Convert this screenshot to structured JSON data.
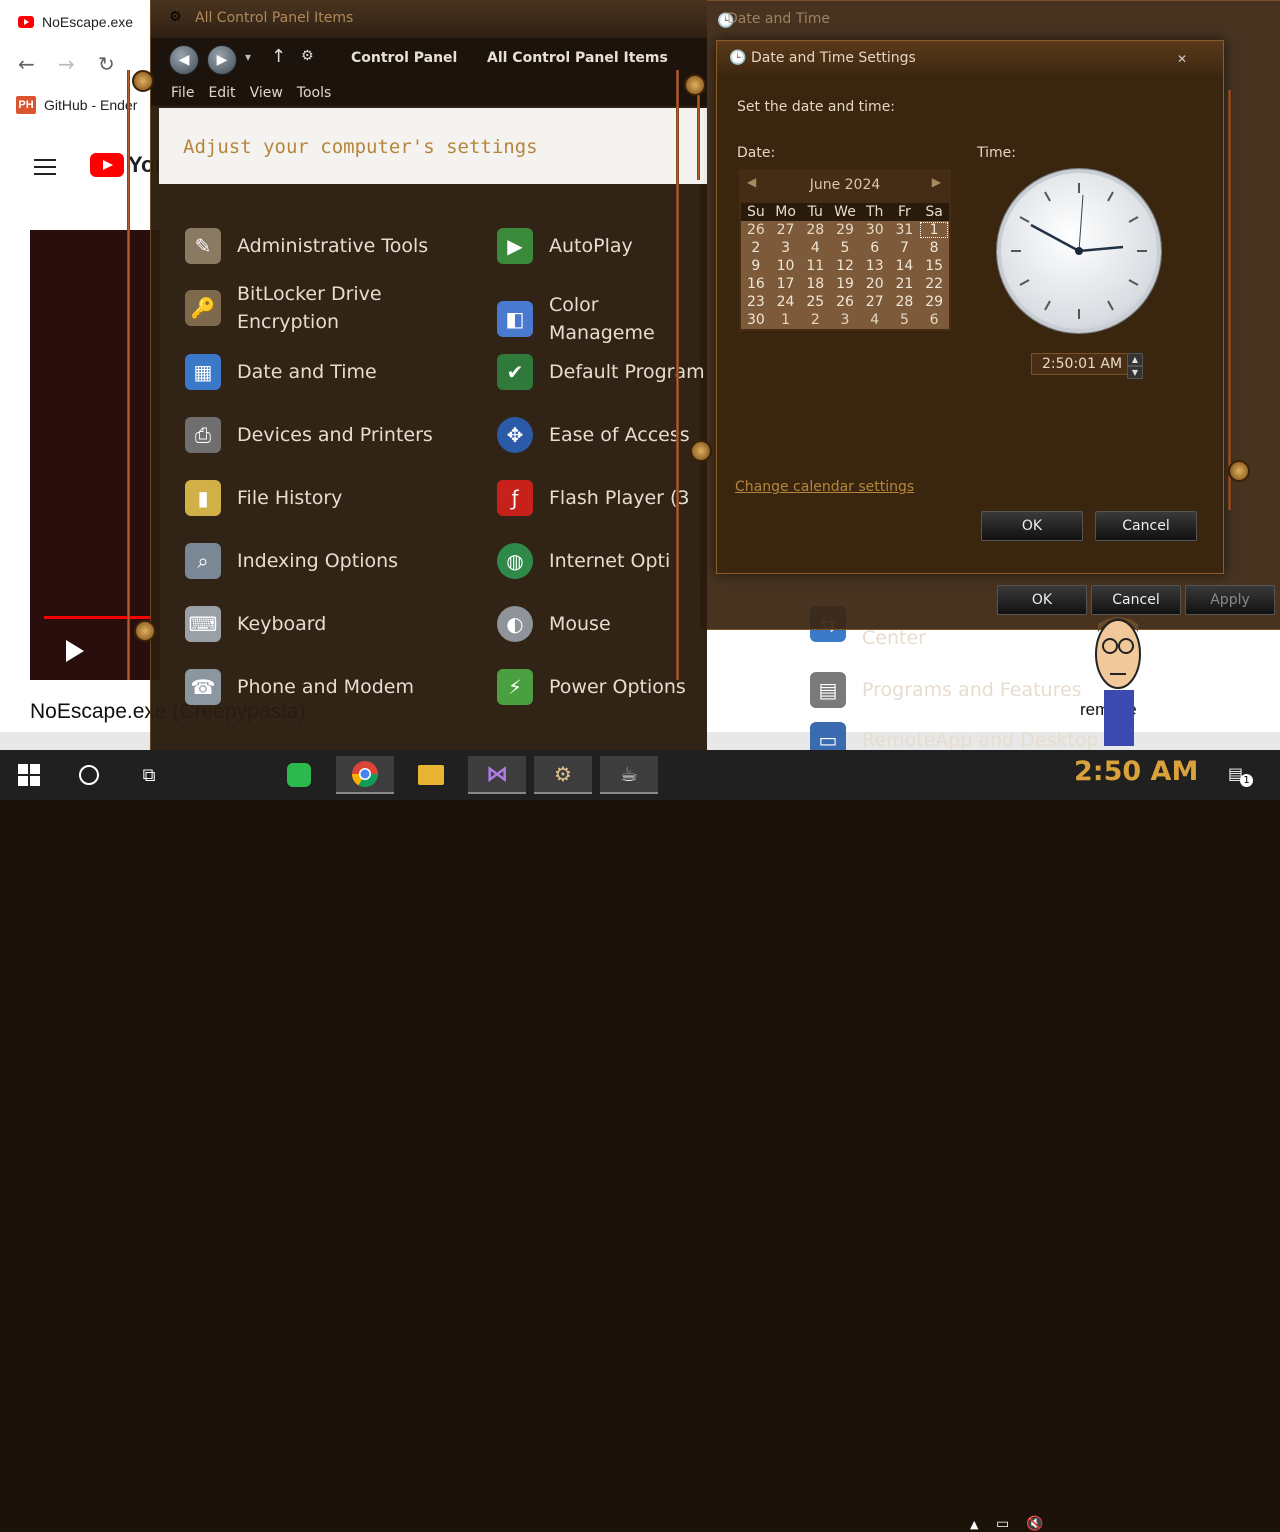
{
  "browser": {
    "tab_title": "NoEscape.exe",
    "bookmark_label": "GitHub - Ender",
    "bookmark_icon_text": "PH",
    "youtube_logo_text": "YouTube",
    "video_title": "NoEscape.exe (Creepypasta)",
    "remove_text": "remove"
  },
  "control_panel": {
    "window_title": "All Control Panel Items",
    "breadcrumb": [
      "Control Panel",
      "All Control Panel Items"
    ],
    "menu": [
      "File",
      "Edit",
      "View",
      "Tools"
    ],
    "heading": "Adjust your computer's settings",
    "items_left": [
      {
        "label": "Administrative Tools",
        "icon": "admin-tools-icon",
        "color": "#8a7a62"
      },
      {
        "label": "BitLocker Drive Encryption",
        "icon": "bitlocker-icon",
        "color": "#7d6a4c"
      },
      {
        "label": "Date and Time",
        "icon": "date-time-icon",
        "color": "#3a78c8"
      },
      {
        "label": "Devices and Printers",
        "icon": "printer-icon",
        "color": "#6f6f6f"
      },
      {
        "label": "File History",
        "icon": "file-history-icon",
        "color": "#d2b048"
      },
      {
        "label": "Indexing Options",
        "icon": "indexing-icon",
        "color": "#7a8794"
      },
      {
        "label": "Keyboard",
        "icon": "keyboard-icon",
        "color": "#9aa0a6"
      },
      {
        "label": "Phone and Modem",
        "icon": "phone-icon",
        "color": "#8c96a0"
      }
    ],
    "items_right": [
      {
        "label": "AutoPlay",
        "icon": "autoplay-icon",
        "color": "#3b8a3b"
      },
      {
        "label": "Color Manageme",
        "icon": "color-management-icon",
        "color": "#4a7ad0"
      },
      {
        "label": "Default Program",
        "icon": "default-programs-icon",
        "color": "#2f7a3a"
      },
      {
        "label": "Ease of Access",
        "icon": "ease-of-access-icon",
        "color": "#2a5aa8"
      },
      {
        "label": "Flash Player (3",
        "icon": "flash-icon",
        "color": "#c8201a"
      },
      {
        "label": "Internet Opti",
        "icon": "internet-options-icon",
        "color": "#2f8a4a"
      },
      {
        "label": "Mouse",
        "icon": "mouse-icon",
        "color": "#8e949a"
      },
      {
        "label": "Power Options",
        "icon": "power-icon",
        "color": "#4aa040"
      }
    ],
    "items_far": [
      {
        "label": "Network and Sharing Center",
        "icon": "network-icon",
        "color": "#3a7ac8"
      },
      {
        "label": "Programs and Features",
        "icon": "programs-icon",
        "color": "#7a7a7a"
      },
      {
        "label": "RemoteApp and Desktop",
        "icon": "remoteapp-icon",
        "color": "#3a6ab0"
      }
    ]
  },
  "date_time_back": {
    "title": "Date and Time",
    "ok_label": "OK",
    "cancel_label": "Cancel",
    "apply_label": "Apply"
  },
  "date_time_settings": {
    "title": "Date and Time Settings",
    "set_label": "Set the date and time:",
    "date_label": "Date:",
    "time_label": "Time:",
    "month": "June 2024",
    "weekdays": [
      "Su",
      "Mo",
      "Tu",
      "We",
      "Th",
      "Fr",
      "Sa"
    ],
    "days": [
      "26",
      "27",
      "28",
      "29",
      "30",
      "31",
      "1",
      "2",
      "3",
      "4",
      "5",
      "6",
      "7",
      "8",
      "9",
      "10",
      "11",
      "12",
      "13",
      "14",
      "15",
      "16",
      "17",
      "18",
      "19",
      "20",
      "21",
      "22",
      "23",
      "24",
      "25",
      "26",
      "27",
      "28",
      "29",
      "30",
      "1",
      "2",
      "3",
      "4",
      "5",
      "6"
    ],
    "time_value": "2:50:01 AM",
    "calendar_settings_link": "Change calendar settings",
    "ok_label": "OK",
    "cancel_label": "Cancel"
  },
  "taskbar": {
    "clock": "2:50 AM",
    "notification_count": "1"
  }
}
